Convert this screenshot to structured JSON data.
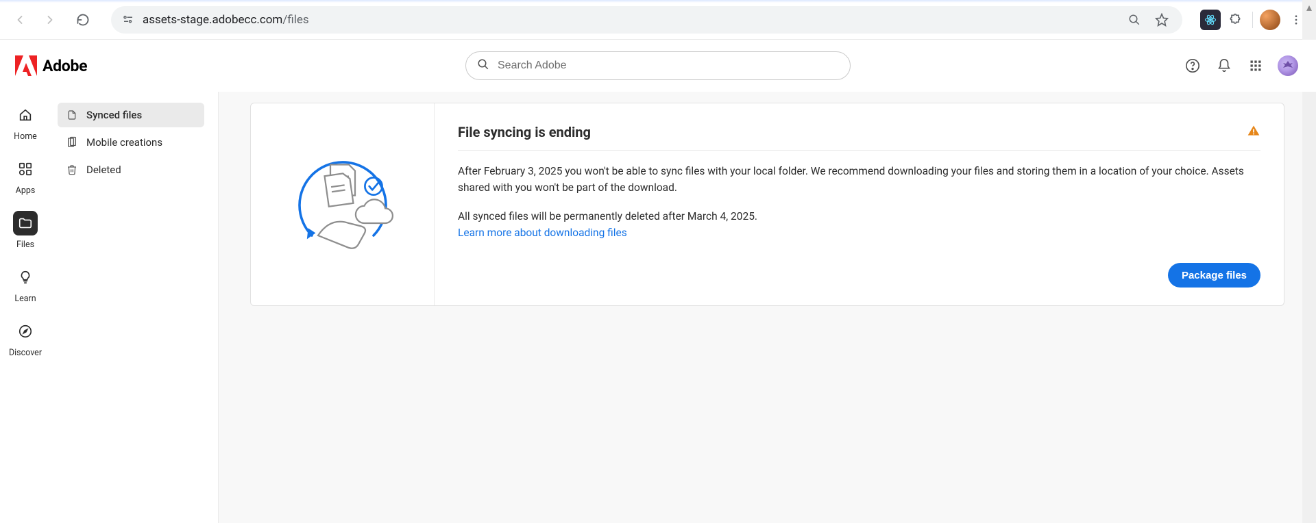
{
  "browser": {
    "url_host": "assets-stage.adobecc.com",
    "url_path": "/files"
  },
  "topbar": {
    "brand": "Adobe",
    "search_placeholder": "Search Adobe"
  },
  "rail": {
    "items": [
      {
        "id": "home",
        "label": "Home",
        "active": false
      },
      {
        "id": "apps",
        "label": "Apps",
        "active": false
      },
      {
        "id": "files",
        "label": "Files",
        "active": true
      },
      {
        "id": "learn",
        "label": "Learn",
        "active": false
      },
      {
        "id": "discover",
        "label": "Discover",
        "active": false
      }
    ]
  },
  "sidebar": {
    "items": [
      {
        "id": "synced",
        "label": "Synced files",
        "active": true
      },
      {
        "id": "mobile",
        "label": "Mobile creations",
        "active": false
      },
      {
        "id": "deleted",
        "label": "Deleted",
        "active": false
      }
    ]
  },
  "notice": {
    "title": "File syncing is ending",
    "body1": "After February 3, 2025 you won't be able to sync files with your local folder. We recommend downloading your files and storing them in a location of your choice. Assets shared with you won't be part of the download.",
    "body2": "All synced files will be permanently deleted after March 4, 2025.",
    "learn_link": "Learn more about downloading files",
    "cta": "Package files"
  }
}
